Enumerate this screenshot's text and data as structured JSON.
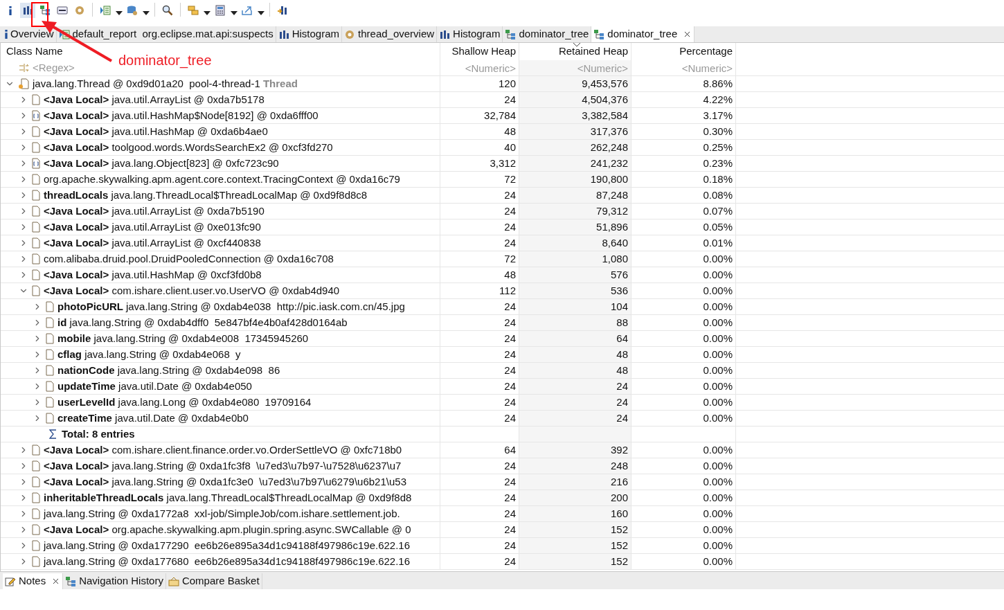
{
  "toolbar": {
    "items": [
      {
        "kind": "info",
        "menu": false,
        "selected": false
      },
      {
        "kind": "histogram",
        "menu": false,
        "selected": true
      },
      {
        "kind": "tree",
        "menu": false,
        "selected": false
      },
      {
        "kind": "oql",
        "menu": false,
        "selected": false
      },
      {
        "kind": "gear",
        "menu": false,
        "selected": false
      },
      {
        "kind": "separator"
      },
      {
        "kind": "report",
        "menu": true,
        "selected": false
      },
      {
        "kind": "database",
        "menu": true,
        "selected": false
      },
      {
        "kind": "separator"
      },
      {
        "kind": "search",
        "menu": false,
        "selected": false
      },
      {
        "kind": "separator"
      },
      {
        "kind": "stack",
        "menu": true,
        "selected": false
      },
      {
        "kind": "calculator",
        "menu": true,
        "selected": false
      },
      {
        "kind": "export",
        "menu": true,
        "selected": false
      },
      {
        "kind": "separator"
      },
      {
        "kind": "chart",
        "menu": false,
        "selected": false
      }
    ]
  },
  "annotation": {
    "text": "dominator_tree"
  },
  "tabs": [
    {
      "label": "Overview",
      "kind": "info",
      "selected": false,
      "closable": false
    },
    {
      "label": "default_report  org.eclipse.mat.api:suspects",
      "kind": "report",
      "selected": false,
      "closable": false
    },
    {
      "label": "Histogram",
      "kind": "histogram",
      "selected": false,
      "closable": false
    },
    {
      "label": "thread_overview",
      "kind": "gear",
      "selected": false,
      "closable": false
    },
    {
      "label": "Histogram",
      "kind": "histogram",
      "selected": false,
      "closable": false
    },
    {
      "label": "dominator_tree",
      "kind": "tree",
      "selected": false,
      "closable": false
    },
    {
      "label": "dominator_tree",
      "kind": "tree",
      "selected": true,
      "closable": true
    }
  ],
  "table": {
    "columns": [
      {
        "label": "Class Name",
        "placeholder": "<Regex>",
        "sorted": false
      },
      {
        "label": "Shallow Heap",
        "placeholder": "<Numeric>",
        "sorted": false
      },
      {
        "label": "Retained Heap",
        "placeholder": "<Numeric>",
        "sorted": true
      },
      {
        "label": "Percentage",
        "placeholder": "<Numeric>",
        "sorted": false
      }
    ],
    "rows": [
      {
        "kind": "thread",
        "text": "java.lang.Thread @ 0xd9d01a20  pool-4-thread-1",
        "suffix": "Thread",
        "shallow": "120",
        "retained": "9,453,576",
        "percentage": "8.86%",
        "expanded": true,
        "children": [
          {
            "kind": "object",
            "label": "<Java Local>",
            "text": "java.util.ArrayList @ 0xda7b5178",
            "shallow": "24",
            "retained": "4,504,376",
            "percentage": "4.22%",
            "expanded": false
          },
          {
            "kind": "array",
            "label": "<Java Local>",
            "text": "java.util.HashMap$Node[8192] @ 0xda6fff00",
            "shallow": "32,784",
            "retained": "3,382,584",
            "percentage": "3.17%",
            "expanded": false
          },
          {
            "kind": "object",
            "label": "<Java Local>",
            "text": "java.util.HashMap @ 0xda6b4ae0",
            "shallow": "48",
            "retained": "317,376",
            "percentage": "0.30%",
            "expanded": false
          },
          {
            "kind": "object",
            "label": "<Java Local>",
            "text": "toolgood.words.WordsSearchEx2 @ 0xcf3fd270",
            "shallow": "40",
            "retained": "262,248",
            "percentage": "0.25%",
            "expanded": false
          },
          {
            "kind": "array",
            "label": "<Java Local>",
            "text": "java.lang.Object[823] @ 0xfc723c90",
            "shallow": "3,312",
            "retained": "241,232",
            "percentage": "0.23%",
            "expanded": false
          },
          {
            "kind": "object",
            "text": "org.apache.skywalking.apm.agent.core.context.TracingContext @ 0xda16c79",
            "shallow": "72",
            "retained": "190,800",
            "percentage": "0.18%",
            "expanded": false
          },
          {
            "kind": "object",
            "label": "threadLocals",
            "text": "java.lang.ThreadLocal$ThreadLocalMap @ 0xd9f8d8c8",
            "shallow": "24",
            "retained": "87,248",
            "percentage": "0.08%",
            "expanded": false
          },
          {
            "kind": "object",
            "label": "<Java Local>",
            "text": "java.util.ArrayList @ 0xda7b5190",
            "shallow": "24",
            "retained": "79,312",
            "percentage": "0.07%",
            "expanded": false
          },
          {
            "kind": "object",
            "label": "<Java Local>",
            "text": "java.util.ArrayList @ 0xe013fc90",
            "shallow": "24",
            "retained": "51,896",
            "percentage": "0.05%",
            "expanded": false
          },
          {
            "kind": "object",
            "label": "<Java Local>",
            "text": "java.util.ArrayList @ 0xcf440838",
            "shallow": "24",
            "retained": "8,640",
            "percentage": "0.01%",
            "expanded": false
          },
          {
            "kind": "object",
            "text": "com.alibaba.druid.pool.DruidPooledConnection @ 0xda16c708",
            "shallow": "72",
            "retained": "1,080",
            "percentage": "0.00%",
            "expanded": false
          },
          {
            "kind": "object",
            "label": "<Java Local>",
            "text": "java.util.HashMap @ 0xcf3fd0b8",
            "shallow": "48",
            "retained": "576",
            "percentage": "0.00%",
            "expanded": false
          },
          {
            "kind": "object",
            "label": "<Java Local>",
            "text": "com.ishare.client.user.vo.UserVO @ 0xdab4d940",
            "shallow": "112",
            "retained": "536",
            "percentage": "0.00%",
            "expanded": true,
            "children": [
              {
                "kind": "object",
                "label": "photoPicURL",
                "text": "java.lang.String @ 0xdab4e038  http://pic.iask.com.cn/45.jpg",
                "shallow": "24",
                "retained": "104",
                "percentage": "0.00%",
                "expanded": false
              },
              {
                "kind": "object",
                "label": "id",
                "text": "java.lang.String @ 0xdab4dff0  5e847bf4e4b0af428d0164ab",
                "shallow": "24",
                "retained": "88",
                "percentage": "0.00%",
                "expanded": false
              },
              {
                "kind": "object",
                "label": "mobile",
                "text": "java.lang.String @ 0xdab4e008  17345945260",
                "shallow": "24",
                "retained": "64",
                "percentage": "0.00%",
                "expanded": false
              },
              {
                "kind": "object",
                "label": "cflag",
                "text": "java.lang.String @ 0xdab4e068  y",
                "shallow": "24",
                "retained": "48",
                "percentage": "0.00%",
                "expanded": false
              },
              {
                "kind": "object",
                "label": "nationCode",
                "text": "java.lang.String @ 0xdab4e098  86",
                "shallow": "24",
                "retained": "48",
                "percentage": "0.00%",
                "expanded": false
              },
              {
                "kind": "object",
                "label": "updateTime",
                "text": "java.util.Date @ 0xdab4e050",
                "shallow": "24",
                "retained": "24",
                "percentage": "0.00%",
                "expanded": false
              },
              {
                "kind": "object",
                "label": "userLevelId",
                "text": "java.lang.Long @ 0xdab4e080  19709164",
                "shallow": "24",
                "retained": "24",
                "percentage": "0.00%",
                "expanded": false
              },
              {
                "kind": "object",
                "label": "createTime",
                "text": "java.util.Date @ 0xdab4e0b0",
                "shallow": "24",
                "retained": "24",
                "percentage": "0.00%",
                "expanded": false
              },
              {
                "kind": "total",
                "text": "Total: 8 entries"
              }
            ]
          },
          {
            "kind": "object",
            "label": "<Java Local>",
            "text": "com.ishare.client.finance.order.vo.OrderSettleVO @ 0xfc718b0",
            "shallow": "64",
            "retained": "392",
            "percentage": "0.00%",
            "expanded": false
          },
          {
            "kind": "object",
            "label": "<Java Local>",
            "text": "java.lang.String @ 0xda1fc3f8  \\u7ed3\\u7b97-\\u7528\\u6237\\u7",
            "shallow": "24",
            "retained": "248",
            "percentage": "0.00%",
            "expanded": false
          },
          {
            "kind": "object",
            "label": "<Java Local>",
            "text": "java.lang.String @ 0xda1fc3e0  \\u7ed3\\u7b97\\u6279\\u6b21\\u53",
            "shallow": "24",
            "retained": "216",
            "percentage": "0.00%",
            "expanded": false
          },
          {
            "kind": "object",
            "label": "inheritableThreadLocals",
            "text": "java.lang.ThreadLocal$ThreadLocalMap @ 0xd9f8d8",
            "shallow": "24",
            "retained": "200",
            "percentage": "0.00%",
            "expanded": false
          },
          {
            "kind": "object",
            "text": "java.lang.String @ 0xda1772a8  xxl-job/SimpleJob/com.ishare.settlement.job.",
            "shallow": "24",
            "retained": "160",
            "percentage": "0.00%",
            "expanded": false
          },
          {
            "kind": "object",
            "label": "<Java Local>",
            "text": "org.apache.skywalking.apm.plugin.spring.async.SWCallable @ 0",
            "shallow": "24",
            "retained": "152",
            "percentage": "0.00%",
            "expanded": false
          },
          {
            "kind": "object",
            "text": "java.lang.String @ 0xda177290  ee6b26e895a34d1c94188f497986c19e.622.16",
            "shallow": "24",
            "retained": "152",
            "percentage": "0.00%",
            "expanded": false
          },
          {
            "kind": "object",
            "text": "java.lang.String @ 0xda177680  ee6b26e895a34d1c94188f497986c19e.622.16",
            "shallow": "24",
            "retained": "152",
            "percentage": "0.00%",
            "expanded": false
          }
        ]
      }
    ]
  },
  "bottom_tabs": [
    {
      "label": "Notes",
      "kind": "note",
      "selected": true,
      "closable": true
    },
    {
      "label": "Navigation History",
      "kind": "tree",
      "selected": false,
      "closable": false
    },
    {
      "label": "Compare Basket",
      "kind": "basket",
      "selected": false,
      "closable": false
    }
  ]
}
